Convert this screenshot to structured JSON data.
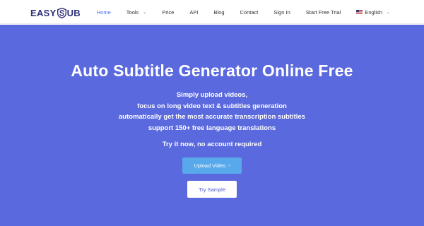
{
  "logo": {
    "left_text": "EASY",
    "right_text": "UB",
    "mark_icon": "s-shield-icon",
    "brand_color": "#2c2f7a"
  },
  "nav": {
    "items": [
      {
        "label": "Home",
        "active": true
      },
      {
        "label": "Tools",
        "has_dropdown": true
      },
      {
        "label": "Price"
      },
      {
        "label": "API"
      },
      {
        "label": "Blog"
      },
      {
        "label": "Contact"
      },
      {
        "label": "Sign In"
      },
      {
        "label": "Start Free Trial"
      },
      {
        "label": "English",
        "has_dropdown": true,
        "icon": "us-flag-icon"
      }
    ],
    "active_color": "#4a6cf7"
  },
  "hero": {
    "background": "#5b69de",
    "title": "Auto Subtitle Generator Online Free",
    "lines": [
      "Simply upload videos,",
      "focus on long video text & subtitles generation",
      "automatically get the most accurate transcription subtitles",
      "support 150+ free language translations"
    ],
    "cta_text": "Try it now, no account required",
    "upload_button": "Upload Video",
    "sample_button": "Try Sample",
    "upload_color": "#58a8ec"
  }
}
